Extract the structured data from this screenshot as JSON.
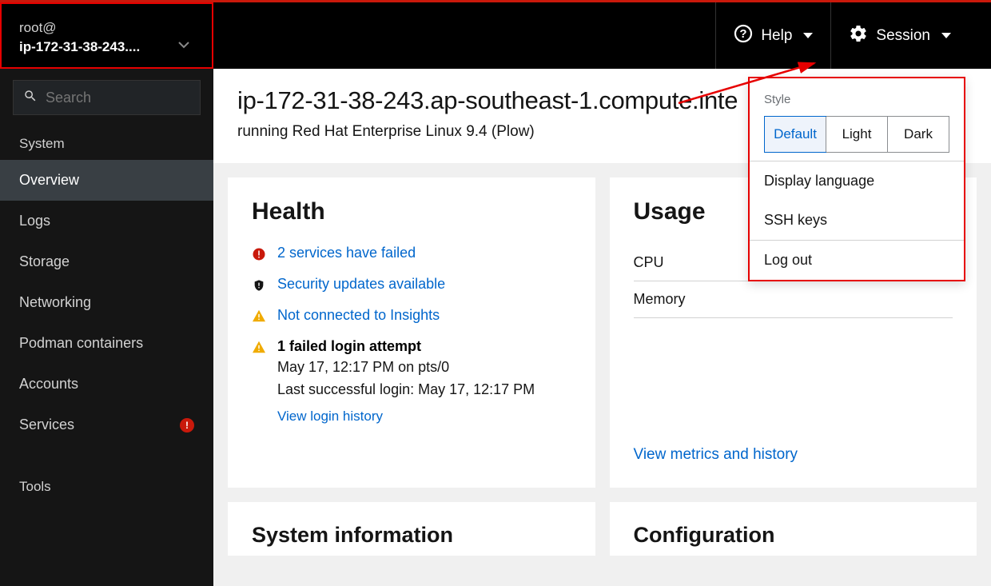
{
  "topbar": {
    "user": "root@",
    "host": "ip-172-31-38-243....",
    "help_label": "Help",
    "session_label": "Session"
  },
  "sidebar": {
    "search_placeholder": "Search",
    "group_system": "System",
    "items": {
      "overview": "Overview",
      "logs": "Logs",
      "storage": "Storage",
      "networking": "Networking",
      "podman": "Podman containers",
      "accounts": "Accounts",
      "services": "Services"
    },
    "group_tools": "Tools"
  },
  "page": {
    "title": "ip-172-31-38-243.ap-southeast-1.compute.inte",
    "sub": "running Red Hat Enterprise Linux 9.4 (Plow)"
  },
  "health": {
    "heading": "Health",
    "failed_services": "2 services have failed",
    "security_updates": "Security updates available",
    "insights": "Not connected to Insights",
    "login_attempt": "1 failed login attempt",
    "login_time": "May 17, 12:17 PM on pts/0",
    "last_success": "Last successful login: May 17, 12:17 PM",
    "view_history": "View login history"
  },
  "usage": {
    "heading": "Usage",
    "cpu_label": "CPU",
    "memory_label": "Memory",
    "link": "View metrics and history"
  },
  "sysinfo": {
    "heading": "System information"
  },
  "config": {
    "heading": "Configuration"
  },
  "session_menu": {
    "style_label": "Style",
    "style_default": "Default",
    "style_light": "Light",
    "style_dark": "Dark",
    "lang": "Display language",
    "ssh": "SSH keys",
    "logout": "Log out"
  }
}
